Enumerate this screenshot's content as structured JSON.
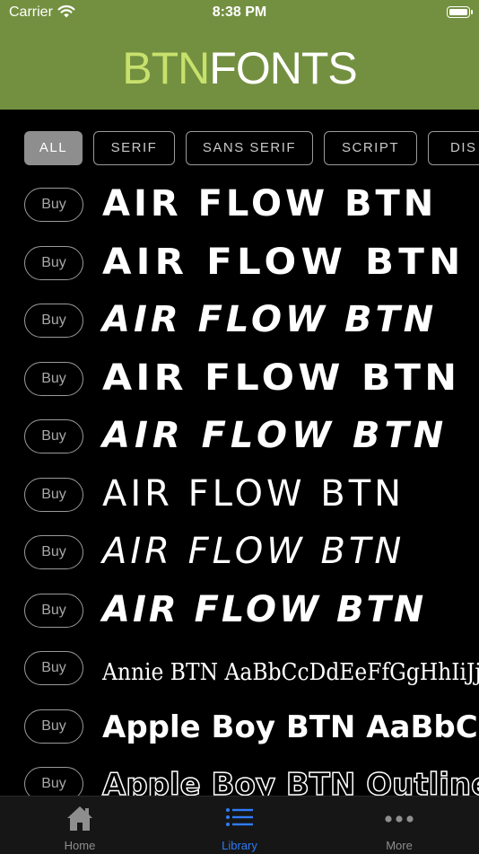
{
  "status": {
    "carrier": "Carrier",
    "time": "8:38 PM"
  },
  "header": {
    "logo_part1": "BTN",
    "logo_part2": "FONTS",
    "logo_color1": "#c8e16d",
    "bg_color": "#739040"
  },
  "filters": [
    {
      "label": "ALL",
      "active": true
    },
    {
      "label": "SERIF",
      "active": false
    },
    {
      "label": "SANS SERIF",
      "active": false
    },
    {
      "label": "SCRIPT",
      "active": false
    },
    {
      "label": "DIS",
      "active": false
    }
  ],
  "buy_label": "Buy",
  "fonts": [
    {
      "sample": "AIR FLOW BTN"
    },
    {
      "sample": "AIR FLOW BTN"
    },
    {
      "sample": "AIR FLOW BTN"
    },
    {
      "sample": "AIR FLOW BTN"
    },
    {
      "sample": "AIR FLOW BTN"
    },
    {
      "sample": "AIR FLOW BTN"
    },
    {
      "sample": "AIR FLOW BTN"
    },
    {
      "sample": "AIR FLOW BTN"
    },
    {
      "sample": "Annie BTN AaBbCcDdEeFfGgHhIiJjKkLlMmNn"
    },
    {
      "sample": "Apple Boy BTN AaBbCcDdEe"
    },
    {
      "sample": "Apple Boy BTN Outline Aa"
    }
  ],
  "tabs": [
    {
      "label": "Home",
      "icon": "home-icon",
      "active": false
    },
    {
      "label": "Library",
      "icon": "list-icon",
      "active": true
    },
    {
      "label": "More",
      "icon": "more-dots-icon",
      "active": false
    }
  ],
  "colors": {
    "accent": "#2f7cf6",
    "inactive": "#8e8e8e"
  }
}
